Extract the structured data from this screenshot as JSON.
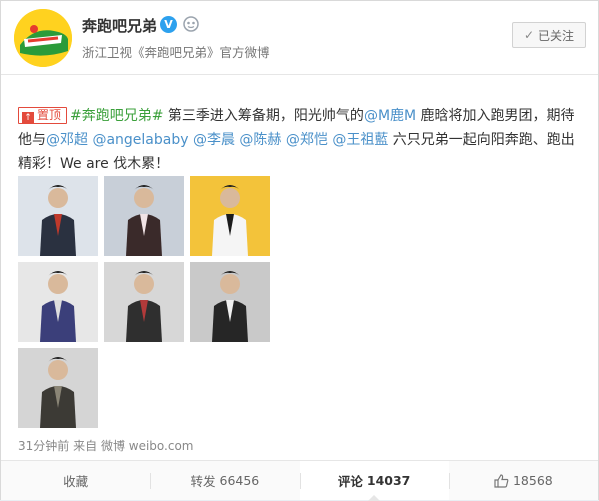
{
  "account": {
    "name": "奔跑吧兄弟",
    "verified_mark": "V",
    "subline": "浙江卫视《奔跑吧兄弟》官方微博",
    "avatar_icon": "show-logo-avatar",
    "follow_label": "已关注"
  },
  "post": {
    "pin_label": "置顶",
    "pin_icon_glyph": "↑",
    "segments": [
      {
        "type": "tag",
        "text": "#奔跑吧兄弟#"
      },
      {
        "type": "txt",
        "text": " 第三季进入筹备期，阳光帅气的"
      },
      {
        "type": "at",
        "text": "@M鹿M"
      },
      {
        "type": "txt",
        "text": " 鹿晗将加入跑男团，期待他与"
      },
      {
        "type": "at",
        "text": "@邓超"
      },
      {
        "type": "txt",
        "text": " "
      },
      {
        "type": "at",
        "text": "@angelababy"
      },
      {
        "type": "txt",
        "text": " "
      },
      {
        "type": "at",
        "text": "@李晨"
      },
      {
        "type": "txt",
        "text": " "
      },
      {
        "type": "at",
        "text": "@陈赫"
      },
      {
        "type": "txt",
        "text": " "
      },
      {
        "type": "at",
        "text": "@郑恺"
      },
      {
        "type": "txt",
        "text": " "
      },
      {
        "type": "at",
        "text": "@王祖藍"
      },
      {
        "type": "txt",
        "text": " 六只兄弟一起向阳奔跑、跑出精彩！We are 伐木累！"
      }
    ],
    "photos": [
      {
        "name": "photo-1",
        "bg": "#dde3ea",
        "fig": "#2a3140",
        "accent": "#c0392b"
      },
      {
        "name": "photo-2",
        "bg": "#c8cfd8",
        "fig": "#3a2a2a",
        "accent": "#f1e4e6"
      },
      {
        "name": "photo-3",
        "bg": "#f3c33a",
        "fig": "#f5f5f5",
        "accent": "#1c1c1c"
      },
      {
        "name": "photo-4",
        "bg": "#e7e7e7",
        "fig": "#3b3f7a",
        "accent": "#dedede"
      },
      {
        "name": "photo-5",
        "bg": "#d7d7d7",
        "fig": "#2f2f2f",
        "accent": "#b23a3a"
      },
      {
        "name": "photo-6",
        "bg": "#c9c9c9",
        "fig": "#262626",
        "accent": "#f0f0f0"
      },
      {
        "name": "photo-7",
        "bg": "#d5d5d5",
        "fig": "#3c3a35",
        "accent": "#8a8576"
      }
    ],
    "time": "31分钟前",
    "from_label": "来自",
    "source": "微博 weibo.com"
  },
  "actions": {
    "favorite": "收藏",
    "repost_label": "转发",
    "repost_count": "66456",
    "comment_label": "评论",
    "comment_count": "14037",
    "like_count": "18568"
  }
}
